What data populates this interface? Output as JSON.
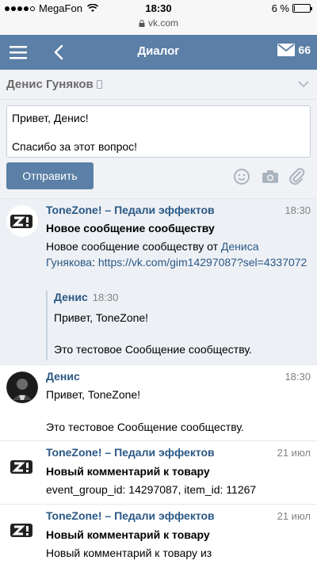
{
  "status_bar": {
    "carrier": "MegaFon",
    "time": "18:30",
    "battery_text": "6 %",
    "battery_level": 0.06,
    "url": "vk.com"
  },
  "navbar": {
    "title": "Диалог",
    "mail_count": "66"
  },
  "dialog": {
    "name": "Денис Гуняков"
  },
  "compose": {
    "text": "Привет, Денис!\n\nСпасибо за этот вопрос!",
    "send_label": "Отправить"
  },
  "messages": [
    {
      "author": "ToneZone! – Педали эффектов",
      "date": "18:30",
      "title": "Новое сообщение сообществу",
      "body_prefix": "Новое сообщение сообществу от ",
      "body_link_name": "Дениса Гунякова",
      "body_colon": ":",
      "body_link_url": "https://vk.com/gim14297087?sel=4337072",
      "quote": {
        "author": "Денис",
        "time": "18:30",
        "text": "Привет, ToneZone!\n\nЭто тестовое Сообщение сообществу."
      }
    },
    {
      "author": "Денис",
      "date": "18:30",
      "line1": "Привет, ToneZone!",
      "line2": "Это тестовое Сообщение сообществу."
    },
    {
      "author": "ToneZone! – Педали эффектов",
      "date": "21 июл",
      "title": "Новый комментарий к товару",
      "body": "event_group_id: 14297087, item_id: 11267"
    },
    {
      "author": "ToneZone! – Педали эффектов",
      "date": "21 июл",
      "title": "Новый комментарий к товару",
      "body": "Новый комментарий к товару из"
    }
  ],
  "colors": {
    "brand": "#5b7fa6",
    "link": "#2a5885",
    "unread_bg": "#edf0f5"
  },
  "icons": [
    "menu-icon",
    "back-icon",
    "mail-icon",
    "smile-icon",
    "camera-icon",
    "paperclip-icon",
    "wifi-icon",
    "lock-icon",
    "chevron-down-icon",
    "phone-icon"
  ]
}
